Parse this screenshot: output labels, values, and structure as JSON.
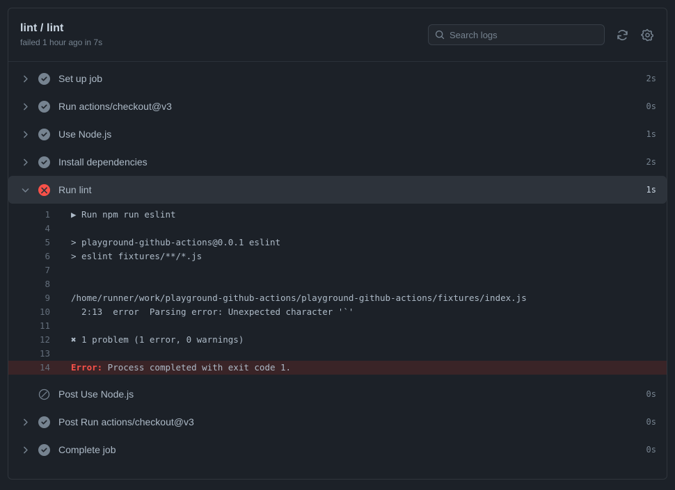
{
  "header": {
    "title": "lint / lint",
    "status": "failed 1 hour ago in 7s",
    "search": {
      "placeholder": "Search logs",
      "value": "",
      "icon": "search-icon"
    },
    "refresh_icon": "refresh-icon",
    "settings_icon": "gear-icon"
  },
  "colors": {
    "page_bg": "#1c2128",
    "panel_bg": "#1c2128",
    "panel_border": "#30363d",
    "row_expanded_bg": "#2d333b",
    "success": "#768390",
    "failure": "#f85149",
    "skipped": "#768390",
    "text_primary": "#adbac7",
    "text_muted": "#768390",
    "error_line_bg": "#3a2427",
    "error_text": "#f85149"
  },
  "steps": [
    {
      "name": "Set up job",
      "status": "success",
      "duration": "2s",
      "expandable": true,
      "expanded": false
    },
    {
      "name": "Run actions/checkout@v3",
      "status": "success",
      "duration": "0s",
      "expandable": true,
      "expanded": false
    },
    {
      "name": "Use Node.js",
      "status": "success",
      "duration": "1s",
      "expandable": true,
      "expanded": false
    },
    {
      "name": "Install dependencies",
      "status": "success",
      "duration": "2s",
      "expandable": true,
      "expanded": false
    },
    {
      "name": "Run lint",
      "status": "failure",
      "duration": "1s",
      "expandable": true,
      "expanded": true
    },
    {
      "name": "Post Use Node.js",
      "status": "skipped",
      "duration": "0s",
      "expandable": false,
      "expanded": false
    },
    {
      "name": "Post Run actions/checkout@v3",
      "status": "success",
      "duration": "0s",
      "expandable": true,
      "expanded": false
    },
    {
      "name": "Complete job",
      "status": "success",
      "duration": "0s",
      "expandable": true,
      "expanded": false
    }
  ],
  "log": {
    "step": "Run lint",
    "lines": [
      {
        "n": "1",
        "text": "▶ Run npm run eslint",
        "marker": "triangle",
        "error": false
      },
      {
        "n": "4",
        "text": "",
        "error": false
      },
      {
        "n": "5",
        "text": "> playground-github-actions@0.0.1 eslint",
        "error": false
      },
      {
        "n": "6",
        "text": "> eslint fixtures/**/*.js",
        "error": false
      },
      {
        "n": "7",
        "text": "",
        "error": false
      },
      {
        "n": "8",
        "text": "",
        "error": false
      },
      {
        "n": "9",
        "text": "/home/runner/work/playground-github-actions/playground-github-actions/fixtures/index.js",
        "error": false
      },
      {
        "n": "10",
        "text": "  2:13  error  Parsing error: Unexpected character '`'",
        "error": false
      },
      {
        "n": "11",
        "text": "",
        "error": false
      },
      {
        "n": "12",
        "text": "✖ 1 problem (1 error, 0 warnings)",
        "error": false
      },
      {
        "n": "13",
        "text": "",
        "error": false
      },
      {
        "n": "14",
        "text": "Error: Process completed with exit code 1.",
        "error": true,
        "error_prefix": "Error:",
        "error_rest": " Process completed with exit code 1."
      }
    ]
  }
}
